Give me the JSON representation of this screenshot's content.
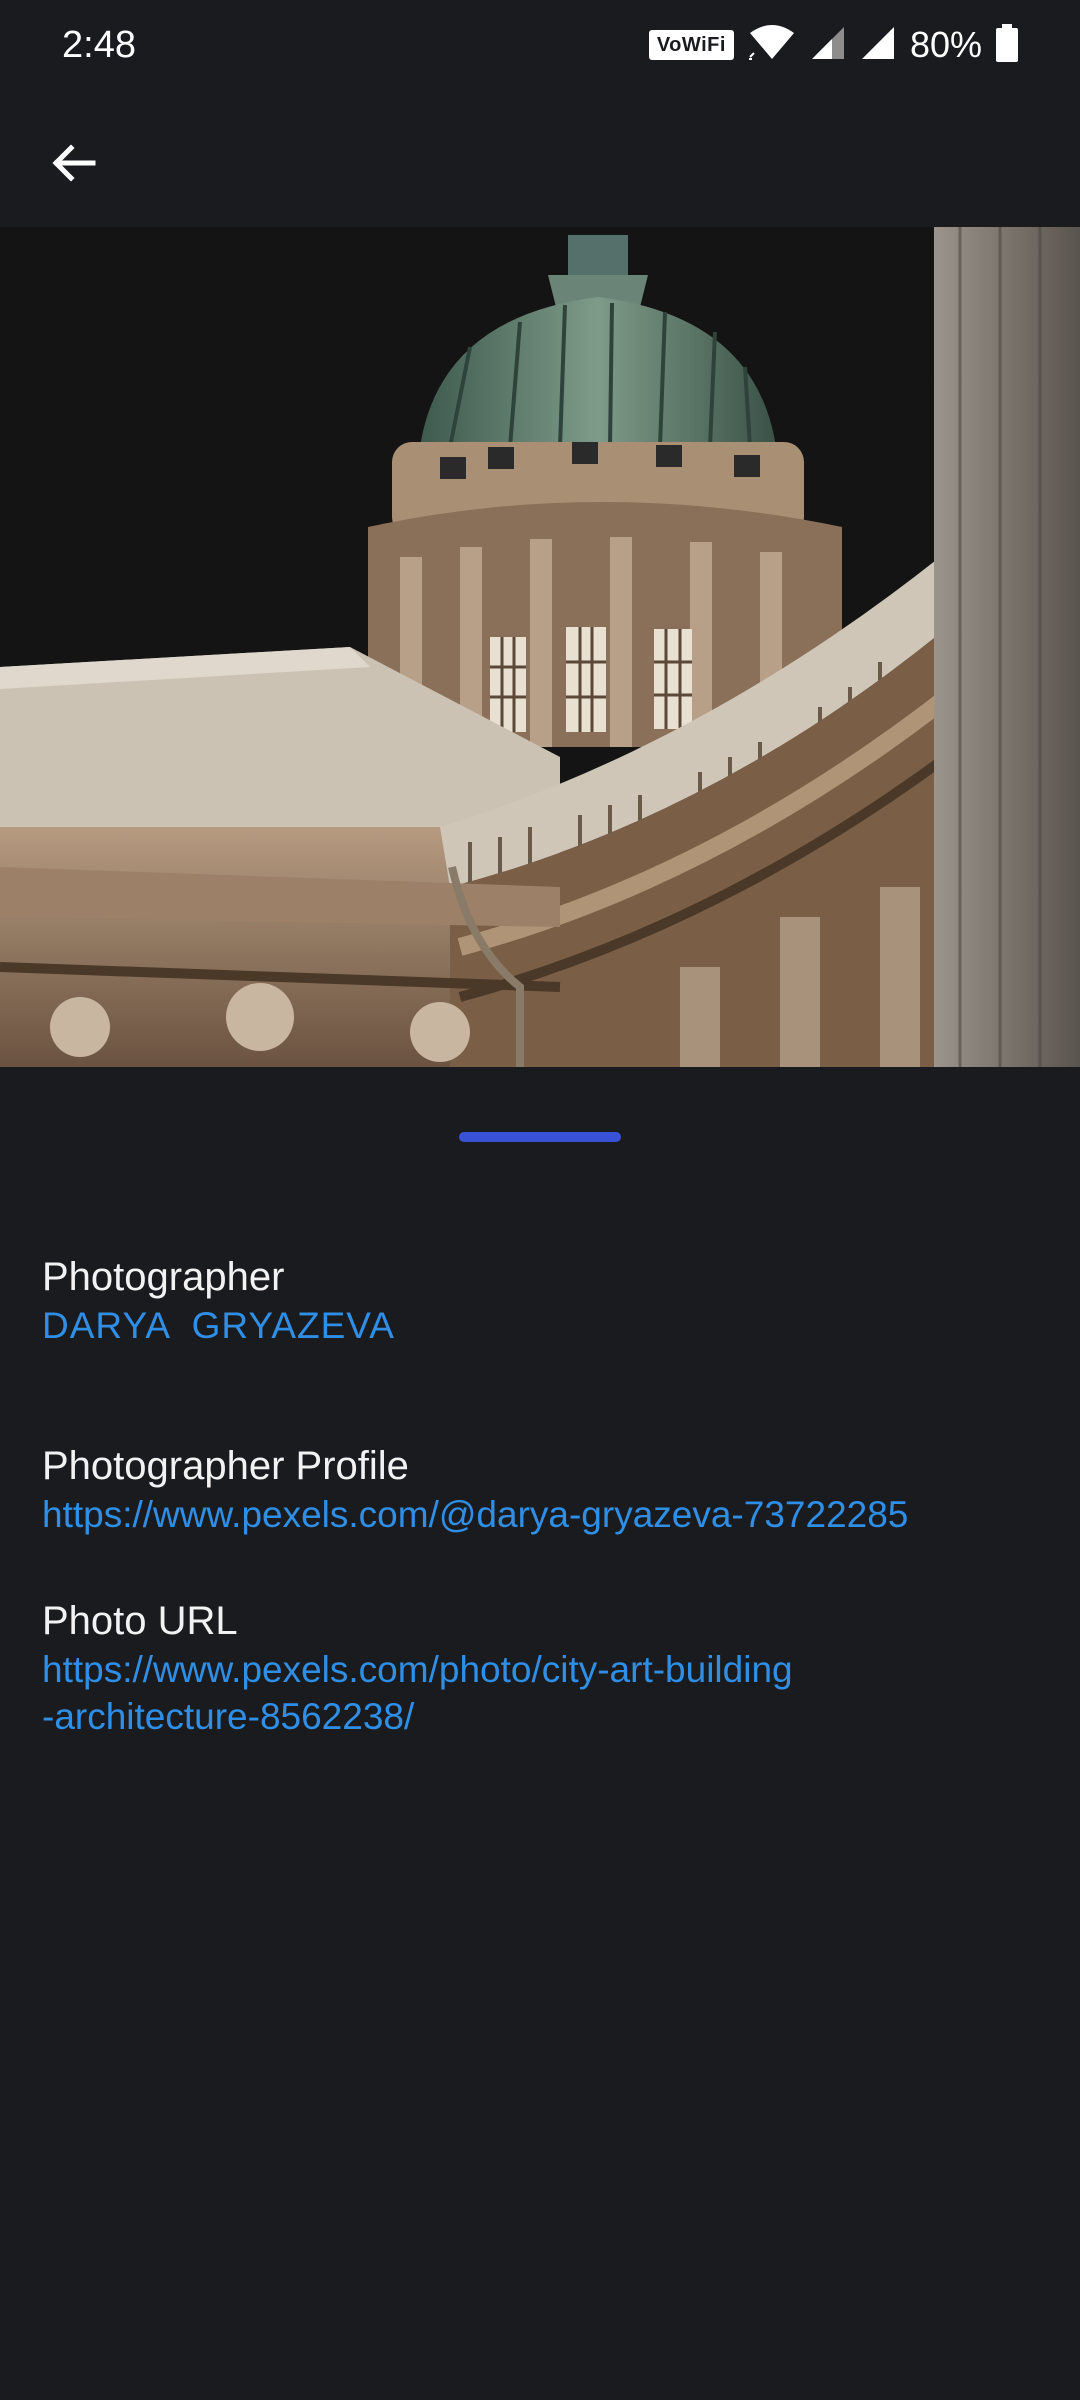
{
  "status_bar": {
    "time": "2:48",
    "vowifi": "VoWiFi",
    "battery": "80%"
  },
  "app_bar": {
    "back_icon": "arrow-left-icon"
  },
  "hero": {
    "subject": "building-photo"
  },
  "details": {
    "photographer_label": "Photographer",
    "photographer_name": "DARYA  GRYAZEVA",
    "profile_label": "Photographer Profile",
    "profile_url": "https://www.pexels.com/@darya-gryazeva-73722285",
    "photo_url_label": "Photo URL",
    "photo_url_line1": "https://www.pexels.com/photo/city-art-building",
    "photo_url_line2": "-architecture-8562238/"
  },
  "colors": {
    "background": "#1a1b1f",
    "link": "#2f8fe6",
    "accent": "#3a53d6",
    "text": "#f2f2f2"
  }
}
